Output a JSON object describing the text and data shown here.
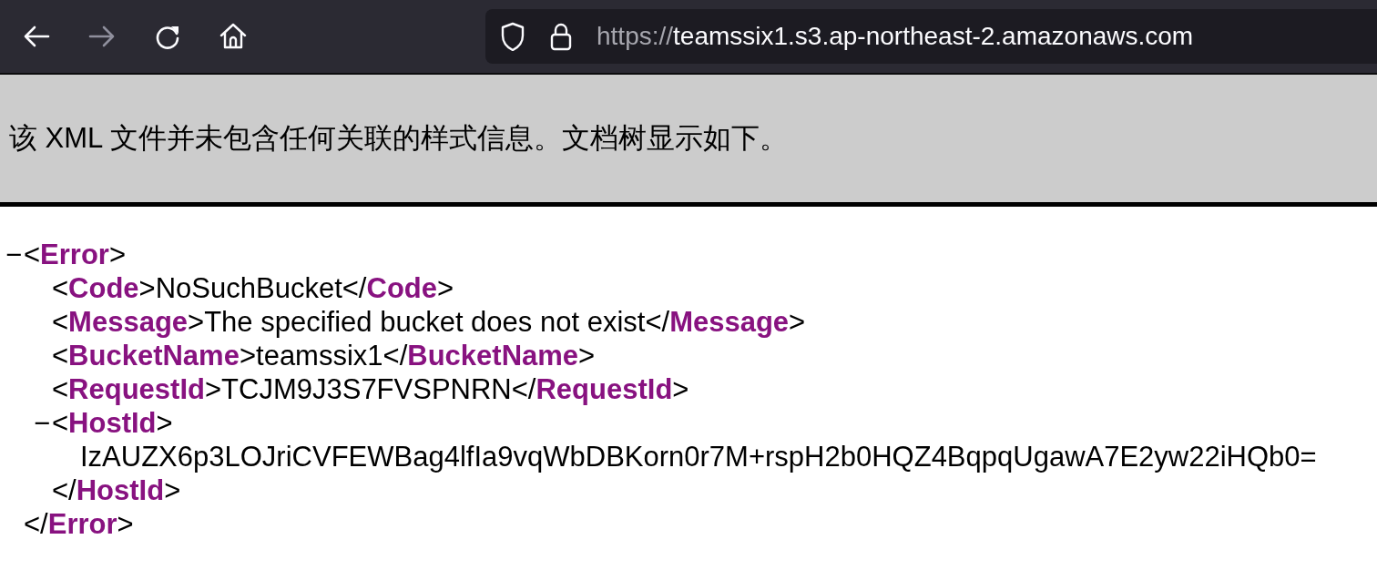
{
  "toolbar": {
    "back_enabled": true,
    "forward_enabled": false
  },
  "address_bar": {
    "scheme": "https://",
    "host": "teamssix1.s3.ap-northeast-2.amazonaws.com"
  },
  "notice": "该 XML 文件并未包含任何关联的样式信息。文档树显示如下。",
  "syntax": {
    "open": "<",
    "close_open": "</",
    "end": ">"
  },
  "xml_tree": {
    "toggle": "−",
    "tag": "Error",
    "close_tag": "Error",
    "children": [
      {
        "tag": "Code",
        "text": "NoSuchBucket",
        "close_tag": "Code"
      },
      {
        "tag": "Message",
        "text": "The specified bucket does not exist",
        "close_tag": "Message"
      },
      {
        "tag": "BucketName",
        "text": "teamssix1",
        "close_tag": "BucketName"
      },
      {
        "tag": "RequestId",
        "text": "TCJM9J3S7FVSPNRN",
        "close_tag": "RequestId"
      },
      {
        "toggle": "−",
        "tag": "HostId",
        "close_tag": "HostId",
        "children": [
          {
            "kind": "text",
            "text": "IzAUZX6p3LOJriCVFEWBag4lfIa9vqWbDBKorn0r7M+rspH2b0HQZ4BqpqUgawA7E2yw22iHQb0="
          }
        ]
      }
    ]
  }
}
